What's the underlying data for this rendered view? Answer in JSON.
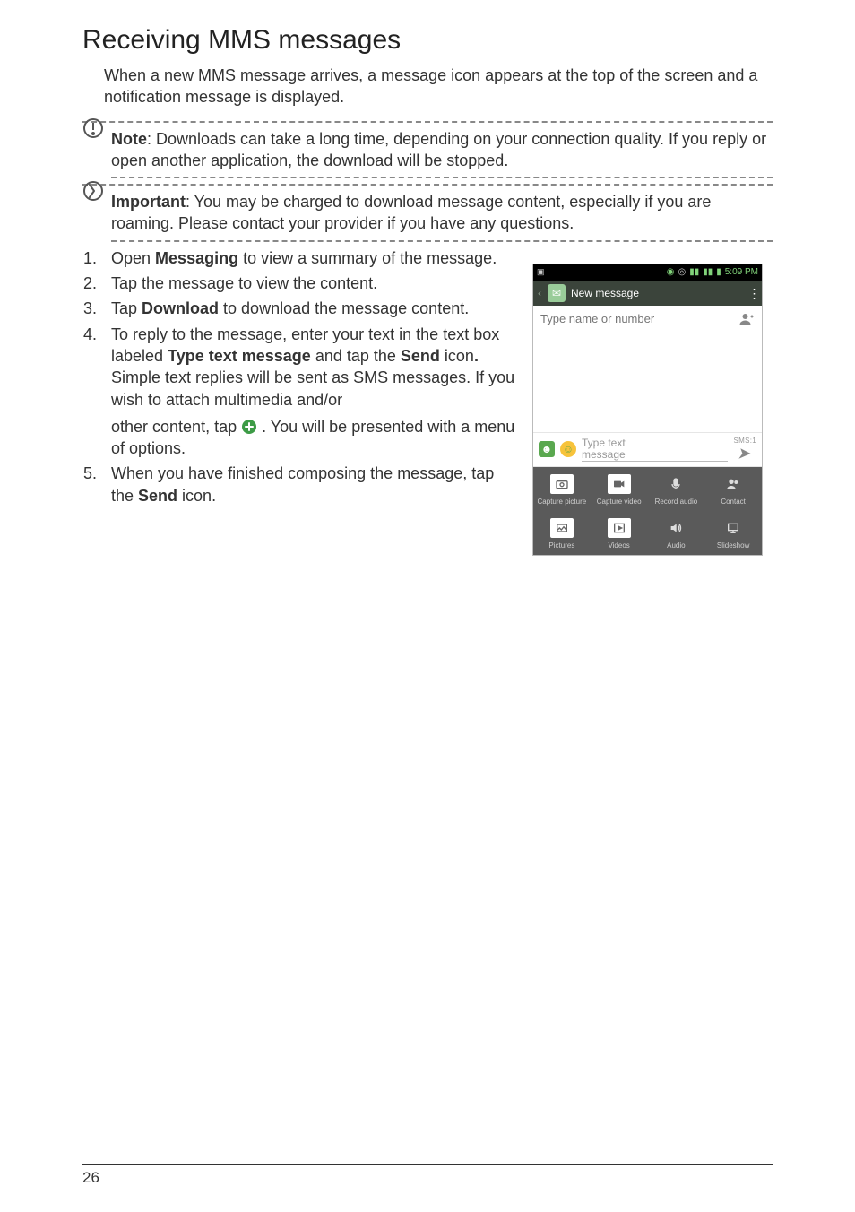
{
  "heading": "Receiving MMS messages",
  "intro": "When a new MMS message arrives, a message icon appears at the top of the screen and a notification message is displayed.",
  "note": {
    "label": "Note",
    "text": ": Downloads can take a long time, depending on your connection quality. If you reply or open another application, the download will be stopped."
  },
  "important": {
    "label": "Important",
    "text": ": You may be charged to download message content, especially if you are roaming. Please contact your provider if you have any questions."
  },
  "steps": {
    "s1a": "Open ",
    "s1b": "Messaging",
    "s1c": " to view a summary of the message.",
    "s2": "Tap the message to view the content.",
    "s3a": "Tap ",
    "s3b": "Download",
    "s3c": " to download the message content.",
    "s4a": "To reply to the message, enter your text in the text box labeled ",
    "s4b": "Type text message",
    "s4c": " and tap the ",
    "s4d": "Send",
    "s4e": " icon",
    "s4f": " Simple text replies will be sent as SMS messages. If you wish to attach multimedia and/or",
    "s4p2a": "other content, tap ",
    "s4p2b": " . You will be presented with a menu of options.",
    "s5a": "When you have finished composing the message, tap the ",
    "s5b": "Send",
    "s5c": " icon."
  },
  "phone": {
    "time": "5:09 PM",
    "appbar_title": "New message",
    "recipient_placeholder": "Type name or number",
    "compose_line1": "Type text",
    "compose_line2": "message",
    "sms_counter": "SMS:1",
    "grid": [
      "Capture picture",
      "Capture video",
      "Record audio",
      "Contact",
      "Pictures",
      "Videos",
      "Audio",
      "Slideshow"
    ]
  },
  "page_number": "26"
}
